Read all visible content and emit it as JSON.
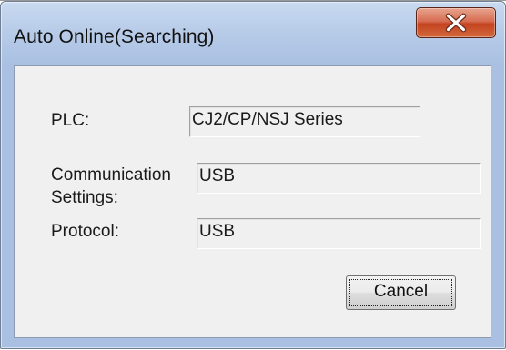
{
  "window": {
    "title": "Auto Online(Searching)"
  },
  "title_bar": {
    "close_icon": "close-icon"
  },
  "form": {
    "plc_label": "PLC:",
    "plc_value": "CJ2/CP/NSJ Series",
    "comm_label_line1": "Communication",
    "comm_label_line2": "Settings:",
    "comm_value": "USB",
    "protocol_label": "Protocol:",
    "protocol_value": "USB"
  },
  "buttons": {
    "cancel_label": "Cancel"
  },
  "colors": {
    "frame": "#a9c0e2",
    "client": "#f0f0f0",
    "close_button": "#c4431f"
  }
}
